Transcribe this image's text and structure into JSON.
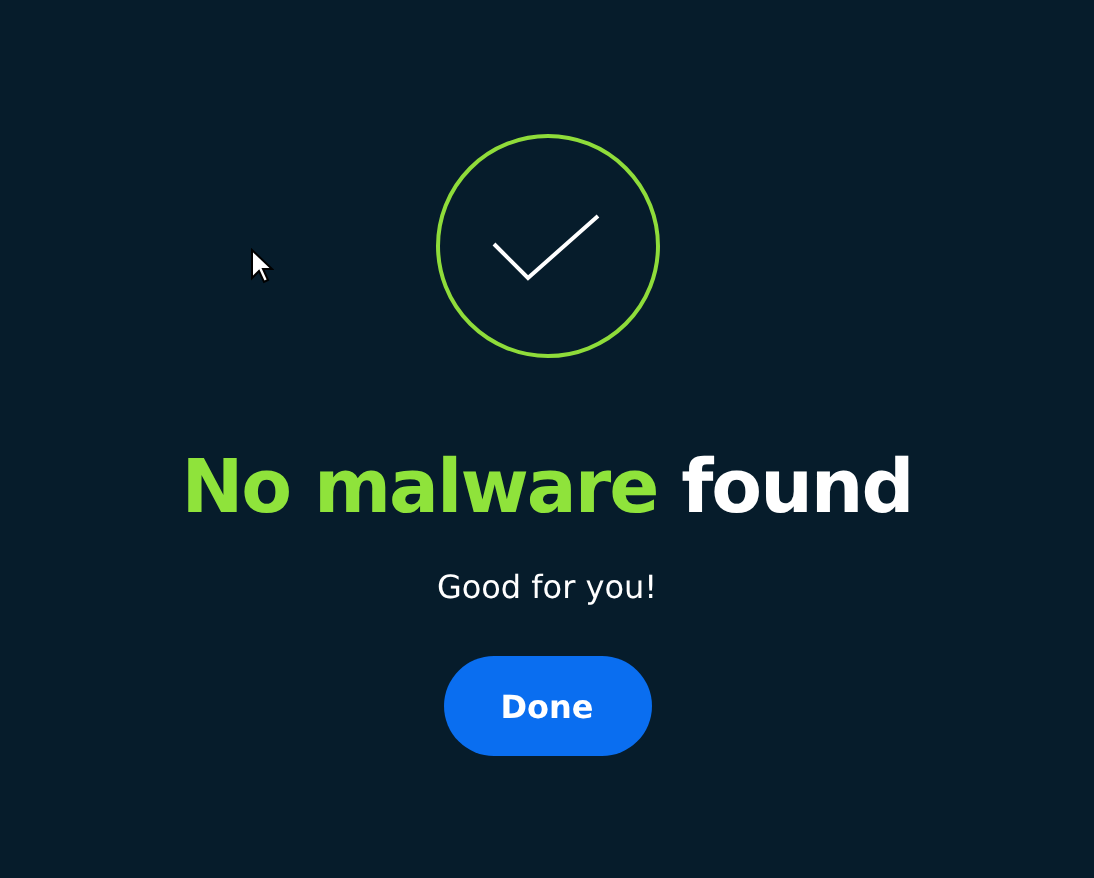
{
  "result": {
    "kind": "clean",
    "title": [
      {
        "text": "No malware",
        "highlighted": true
      },
      {
        "text": "found",
        "highlighted": false
      }
    ],
    "message": "Good for you!",
    "button": "Done"
  }
}
